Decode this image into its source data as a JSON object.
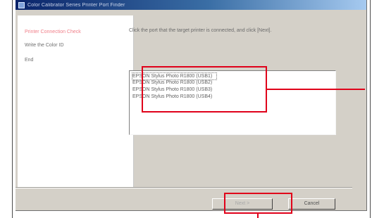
{
  "window": {
    "title": "Color Calibrator Series Printer Port Finder"
  },
  "steps": [
    {
      "label": "Printer Connection Check",
      "active": true
    },
    {
      "label": "Write the Color ID",
      "active": false
    },
    {
      "label": "End",
      "active": false
    }
  ],
  "instruction": "Click the port that the target printer is connected, and click [Next].",
  "ports": [
    "EPSON Stylus Photo R1800 (USB1)",
    "EPSON Stylus Photo R1800 (USB2)",
    "EPSON Stylus Photo R1800 (USB3)",
    "EPSON Stylus Photo R1800 (USB4)"
  ],
  "buttons": {
    "next_label": "Next >",
    "cancel_label": "Cancel"
  },
  "colors": {
    "highlight": "#e0001a",
    "active_step": "#f07e88"
  }
}
